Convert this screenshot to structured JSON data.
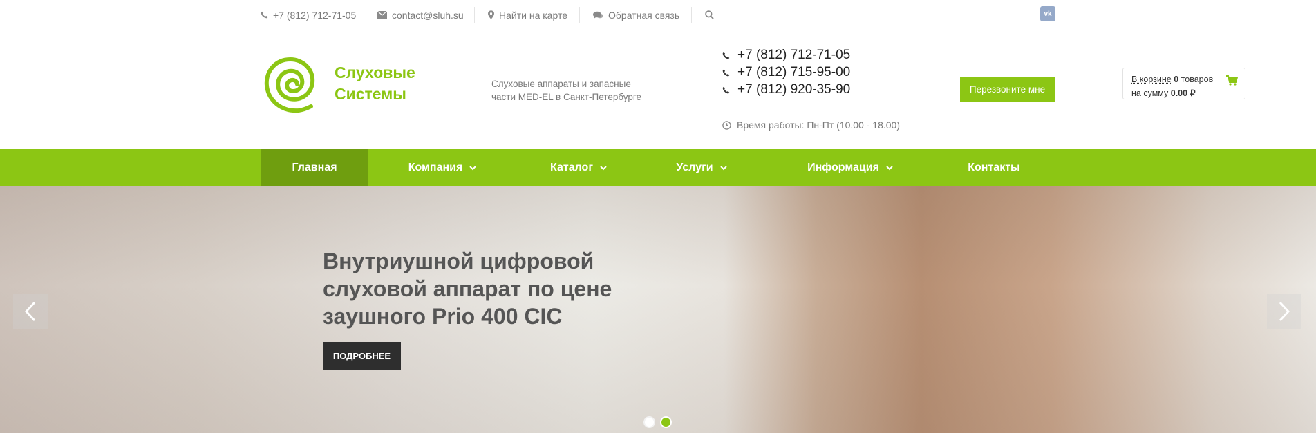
{
  "topbar": {
    "phone": "+7 (812) 712-71-05",
    "email": "contact@sluh.su",
    "map": "Найти на карте",
    "feedback": "Обратная связь",
    "vk": "vk"
  },
  "header": {
    "logo_line1": "Слуховые",
    "logo_line2": "Системы",
    "tagline": "Слуховые аппараты и запасные части MED-EL в Санкт-Петербурге",
    "phones": [
      "+7 (812) 712-71-05",
      "+7 (812) 715-95-00",
      "+7 (812) 920-35-90"
    ],
    "worktime": "Время работы: Пн-Пт (10.00 - 18.00)",
    "callback": "Перезвоните мне",
    "cart": {
      "in_cart": "В корзине",
      "count": "0",
      "items_word": "товаров",
      "sum_label": "на сумму",
      "sum": "0.00",
      "currency": "₽"
    }
  },
  "nav": {
    "items": [
      "Главная",
      "Компания",
      "Каталог",
      "Услуги",
      "Информация",
      "Контакты"
    ]
  },
  "hero": {
    "title": "Внутриушной цифровой слуховой аппарат по цене заушного Prio 400 CIC",
    "button": "ПОДРОБНЕЕ",
    "active_slide": 2,
    "slide_count": 2
  },
  "colors": {
    "accent": "#8cc614",
    "accent_dark": "#6f9e0f",
    "button_dark": "#2e2e2e"
  }
}
